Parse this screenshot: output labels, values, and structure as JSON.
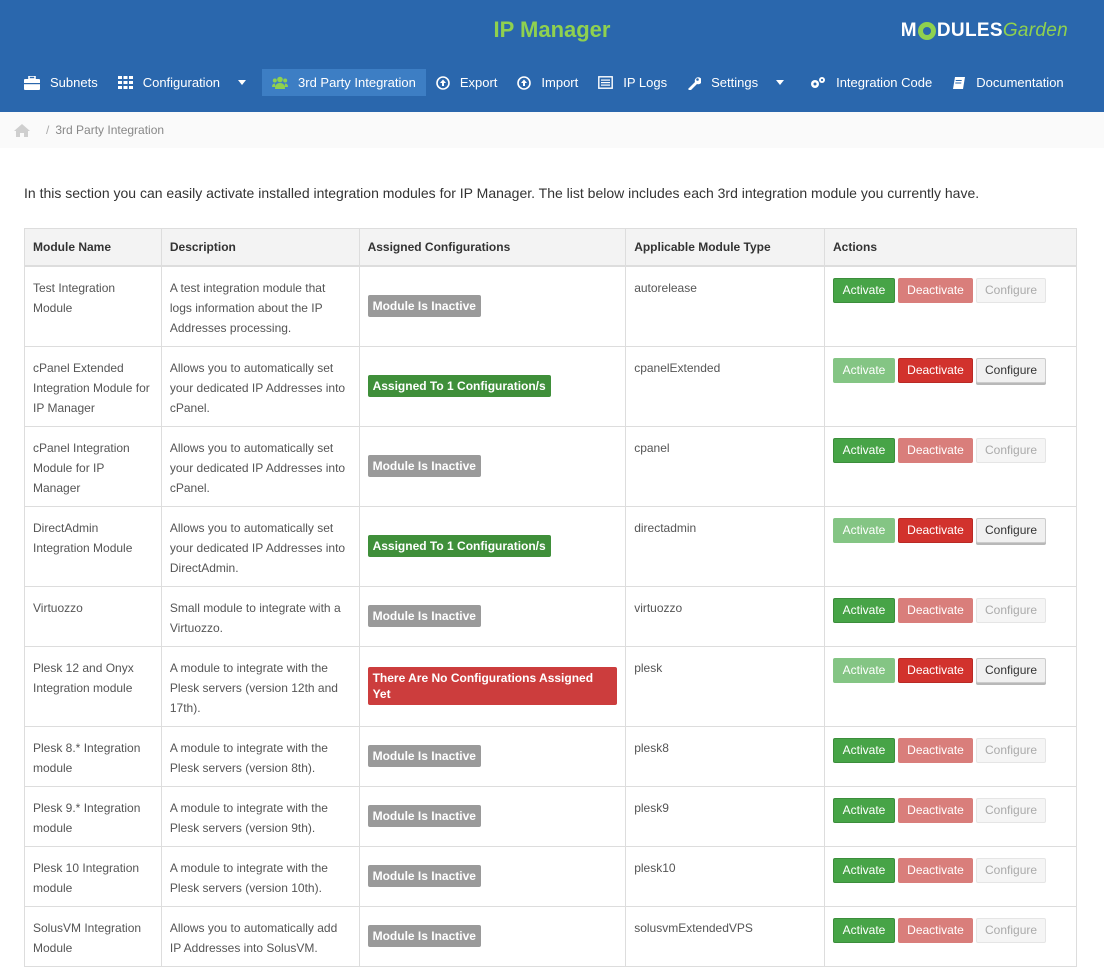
{
  "header": {
    "title": "IP Manager",
    "brand_part1": "M",
    "brand_part2": "DULES",
    "brand_part3": "Garden"
  },
  "nav": [
    {
      "label": "Subnets",
      "icon": "briefcase-icon"
    },
    {
      "label": "Configuration",
      "icon": "grid-icon"
    },
    {
      "label": "3rd Party Integration",
      "icon": "users-icon"
    },
    {
      "label": "Export",
      "icon": "export-icon"
    },
    {
      "label": "Import",
      "icon": "import-icon"
    },
    {
      "label": "IP Logs",
      "icon": "list-icon"
    },
    {
      "label": "Settings",
      "icon": "wrench-icon"
    },
    {
      "label": "Integration Code",
      "icon": "cogs-icon"
    },
    {
      "label": "Documentation",
      "icon": "book-icon"
    }
  ],
  "breadcrumb": {
    "current": "3rd Party Integration"
  },
  "intro": "In this section you can easily activate installed integration modules for IP Manager. The list below includes each 3rd integration module you currently have.",
  "table": {
    "headers": [
      "Module Name",
      "Description",
      "Assigned Configurations",
      "Applicable Module Type",
      "Actions"
    ],
    "buttons": {
      "activate": "Activate",
      "deactivate": "Deactivate",
      "configure": "Configure"
    },
    "rows": [
      {
        "name": "Test Integration Module",
        "description": "A test integration module that logs information about the IP Addresses processing.",
        "status": "Module Is Inactive",
        "status_type": "inactive",
        "type": "autorelease",
        "active": false
      },
      {
        "name": "cPanel Extended Integration Module for IP Manager",
        "description": "Allows you to automatically set your dedicated IP Addresses into cPanel.",
        "status": "Assigned To 1 Configuration/s",
        "status_type": "assigned",
        "type": "cpanelExtended",
        "active": true
      },
      {
        "name": "cPanel Integration Module for IP Manager",
        "description": "Allows you to automatically set your dedicated IP Addresses into cPanel.",
        "status": "Module Is Inactive",
        "status_type": "inactive",
        "type": "cpanel",
        "active": false
      },
      {
        "name": "DirectAdmin Integration Module",
        "description": "Allows you to automatically set your dedicated IP Addresses into DirectAdmin.",
        "status": "Assigned To 1 Configuration/s",
        "status_type": "assigned",
        "type": "directadmin",
        "active": true
      },
      {
        "name": "Virtuozzo",
        "description": "Small module to integrate with a Virtuozzo.",
        "status": "Module Is Inactive",
        "status_type": "inactive",
        "type": "virtuozzo",
        "active": false
      },
      {
        "name": "Plesk 12 and Onyx Integration module",
        "description": "A module to integrate with the Plesk servers (version 12th and 17th).",
        "status": "There Are No Configurations Assigned Yet",
        "status_type": "none",
        "type": "plesk",
        "active": true
      },
      {
        "name": "Plesk 8.* Integration module",
        "description": "A module to integrate with the Plesk servers (version 8th).",
        "status": "Module Is Inactive",
        "status_type": "inactive",
        "type": "plesk8",
        "active": false
      },
      {
        "name": "Plesk 9.* Integration module",
        "description": "A module to integrate with the Plesk servers (version 9th).",
        "status": "Module Is Inactive",
        "status_type": "inactive",
        "type": "plesk9",
        "active": false
      },
      {
        "name": "Plesk 10 Integration module",
        "description": "A module to integrate with the Plesk servers (version 10th).",
        "status": "Module Is Inactive",
        "status_type": "inactive",
        "type": "plesk10",
        "active": false
      },
      {
        "name": "SolusVM Integration Module",
        "description": "Allows you to automatically add IP Addresses into SolusVM.",
        "status": "Module Is Inactive",
        "status_type": "inactive",
        "type": "solusvmExtendedVPS",
        "active": false
      }
    ]
  },
  "colors": {
    "header_bg": "#2a67ad",
    "title_green": "#8fd14f",
    "active_nav": "#3d7ec4",
    "success": "#47a447",
    "danger": "#d2322d"
  }
}
